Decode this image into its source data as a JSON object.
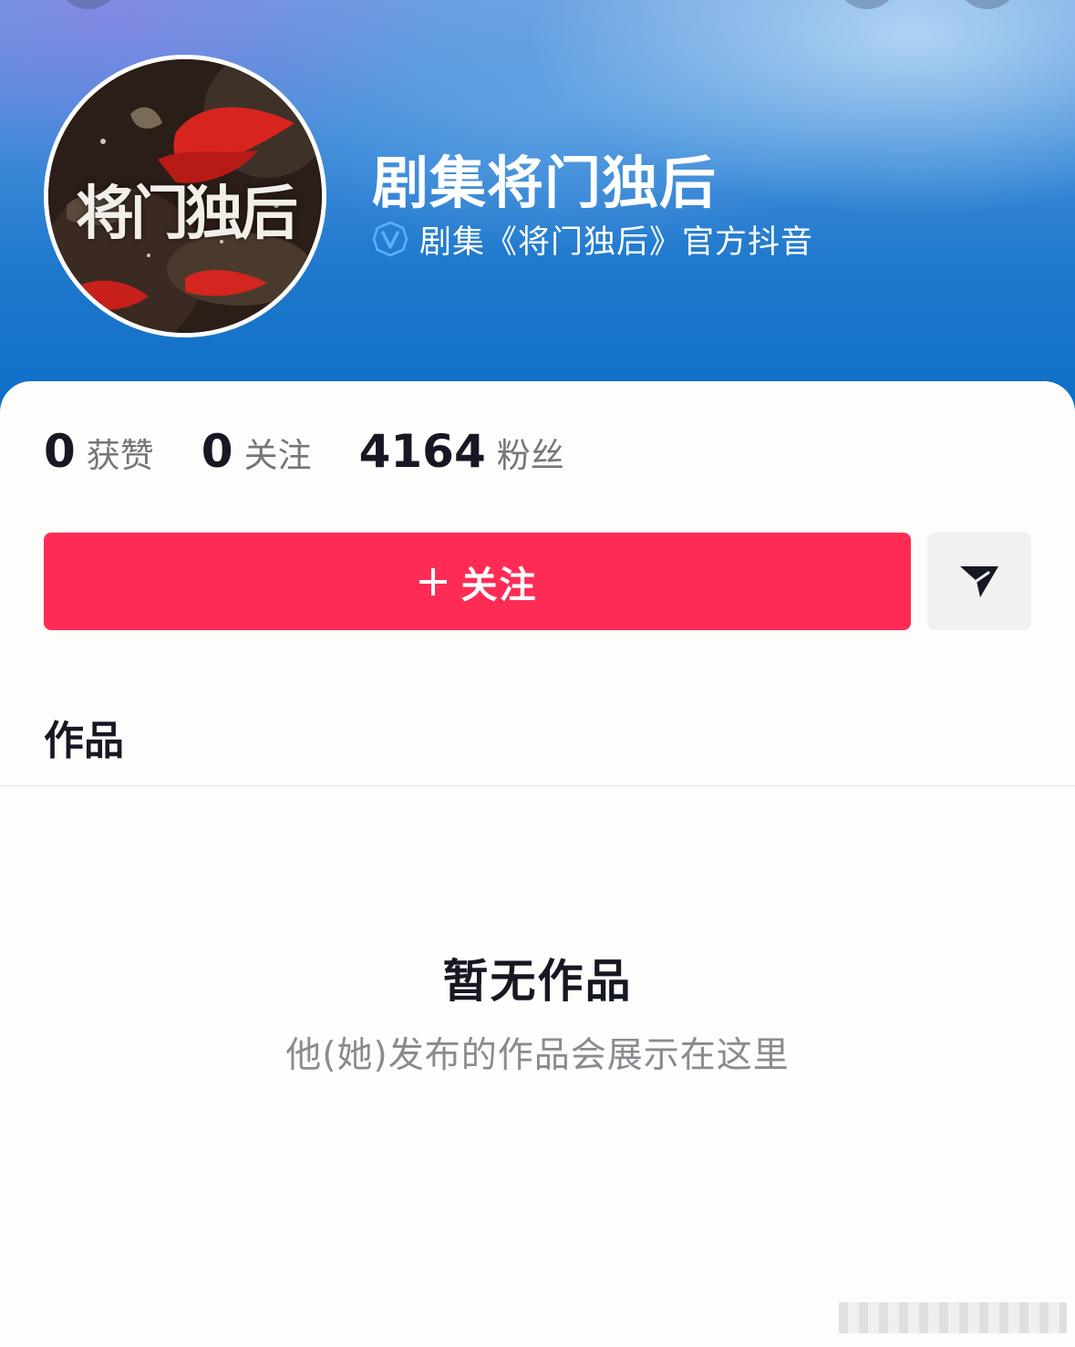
{
  "profile": {
    "avatar_text": "将门独后",
    "name": "剧集将门独后",
    "verify_text": "剧集《将门独后》官方抖音"
  },
  "stats": [
    {
      "number": "0",
      "label": "获赞"
    },
    {
      "number": "0",
      "label": "关注"
    },
    {
      "number": "4164",
      "label": "粉丝"
    }
  ],
  "actions": {
    "follow_label": "关注",
    "share_icon": "send-icon"
  },
  "tabs": {
    "works_label": "作品"
  },
  "empty_state": {
    "title": "暂无作品",
    "subtitle": "他(她)发布的作品会展示在这里"
  },
  "colors": {
    "accent": "#fe2c55",
    "banner_blue": "#1e78cc",
    "verified_blue": "#4aa3ff"
  }
}
